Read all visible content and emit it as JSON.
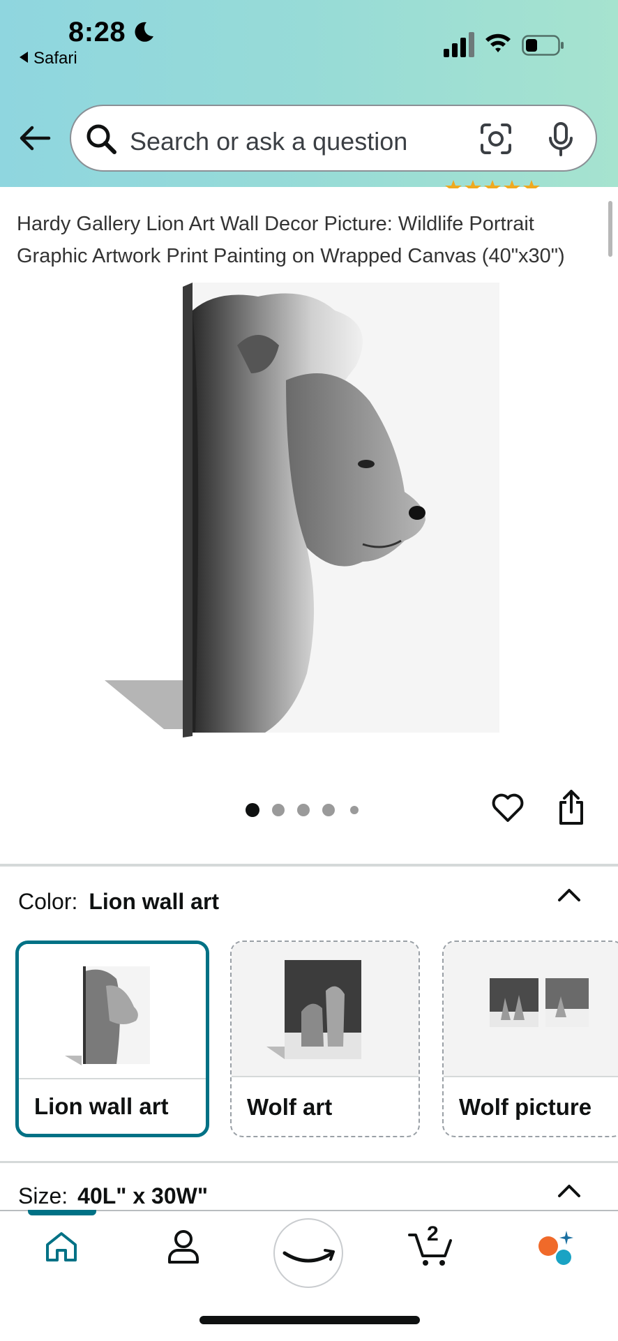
{
  "status_bar": {
    "time": "8:28",
    "back_app": "Safari"
  },
  "search": {
    "placeholder": "Search or ask a question"
  },
  "product": {
    "title": "Hardy Gallery Lion Art Wall Decor Picture: Wildlife Portrait Graphic Artwork Print Painting on Wrapped Canvas (40\"x30\")",
    "image_count": 5,
    "active_image": 1
  },
  "color_selector": {
    "label": "Color:",
    "selected_value": "Lion wall art",
    "options": [
      {
        "label": "Lion wall art",
        "selected": true
      },
      {
        "label": "Wolf art",
        "selected": false
      },
      {
        "label": "Wolf picture",
        "selected": false
      }
    ]
  },
  "size_selector": {
    "label": "Size:",
    "selected_value": "40L\" x 30W\""
  },
  "tab_bar": {
    "items": [
      "home-icon",
      "account-icon",
      "amazon-icon",
      "cart-icon",
      "rufus-icon"
    ],
    "cart_count": "2",
    "accent_color": "#007185"
  }
}
